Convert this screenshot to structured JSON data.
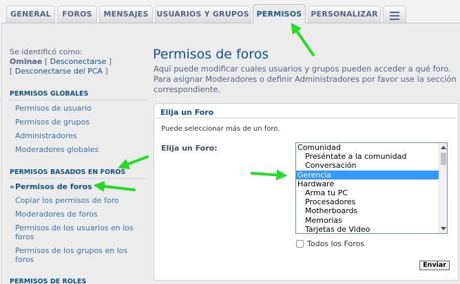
{
  "tabs": [
    {
      "label": "GENERAL"
    },
    {
      "label": "FOROS"
    },
    {
      "label": "MENSAJES"
    },
    {
      "label": "USUARIOS Y GRUPOS"
    },
    {
      "label": "PERMISOS",
      "active": true
    },
    {
      "label": "PERSONALIZAR"
    },
    {
      "label": "",
      "icon": "menu-icon"
    }
  ],
  "login": {
    "identified_as": "Se identificó como:",
    "username": "Ominae",
    "logout": "Desconectarse",
    "logout_acp": "Desconectarse del PCA",
    "bracket_open": "[",
    "bracket_close": "]"
  },
  "sidebar": {
    "global": {
      "heading": "PERMISOS GLOBALES",
      "items": [
        "Permisos de usuario",
        "Permisos de grupos",
        "Administradores",
        "Moderadores globales"
      ]
    },
    "forum_based": {
      "heading": "PERMISOS BASADOS EN FOROS",
      "items": [
        "Permisos de foros",
        "Copiar los permisos de foro",
        "Moderadores de foros",
        "Permisos de los usuarios en los foros",
        "Permisos de los grupos en los foros"
      ],
      "active_index": 0,
      "bullet": "»"
    },
    "roles": {
      "heading": "PERMISOS DE ROLES"
    }
  },
  "main": {
    "title": "Permisos de foros",
    "description": "Aquí puede modificar cuales usuarios y grupos pueden acceder a qué foro. Para asignar Moderadores o definir Administradores por favor use la sección correspondiente.",
    "panel": {
      "legend": "Elija un Foro",
      "hint": "Puede seleccionar más de un foro.",
      "field_label": "Elija un Foro:",
      "options": [
        {
          "label": "Comunidad",
          "level": 0
        },
        {
          "label": "Preséntate a la comunidad",
          "level": 1
        },
        {
          "label": "Conversación",
          "level": 1
        },
        {
          "label": "Gerencia",
          "level": 0,
          "selected": true
        },
        {
          "label": "Hardware",
          "level": 0
        },
        {
          "label": "Arma tu PC",
          "level": 1
        },
        {
          "label": "Procesadores",
          "level": 1
        },
        {
          "label": "Motherboards",
          "level": 1
        },
        {
          "label": "Memorias",
          "level": 1
        },
        {
          "label": "Tarjetas de Video",
          "level": 1
        }
      ],
      "all_forums_label": "Todos los Foros",
      "all_forums_checked": false,
      "submit_label": "Enviar"
    }
  },
  "colors": {
    "accent": "#105289",
    "selection": "#3399ff",
    "annotation_arrow": "#22dd22"
  }
}
